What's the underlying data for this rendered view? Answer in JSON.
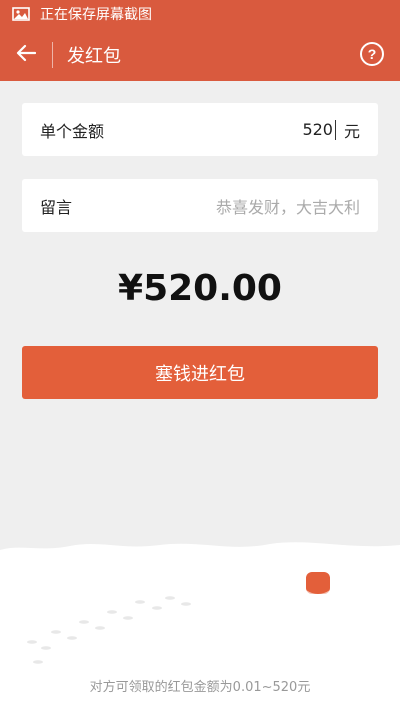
{
  "status_bar": {
    "icon": "image-icon",
    "text": "正在保存屏幕截图"
  },
  "app_bar": {
    "back_icon": "arrow-left-icon",
    "title": "发红包",
    "help_icon": "question-circle-icon",
    "help_symbol": "?"
  },
  "amount_row": {
    "label": "单个金额",
    "value": "520",
    "unit": "元"
  },
  "message_row": {
    "label": "留言",
    "placeholder": "恭喜发财，大吉大利"
  },
  "total": "¥520.00",
  "send_button": "塞钱进红包",
  "footer_note": "对方可领取的红包金额为0.01~520元",
  "colors": {
    "accent": "#d95a3e",
    "button": "#e35f3a",
    "background": "#efefef"
  }
}
